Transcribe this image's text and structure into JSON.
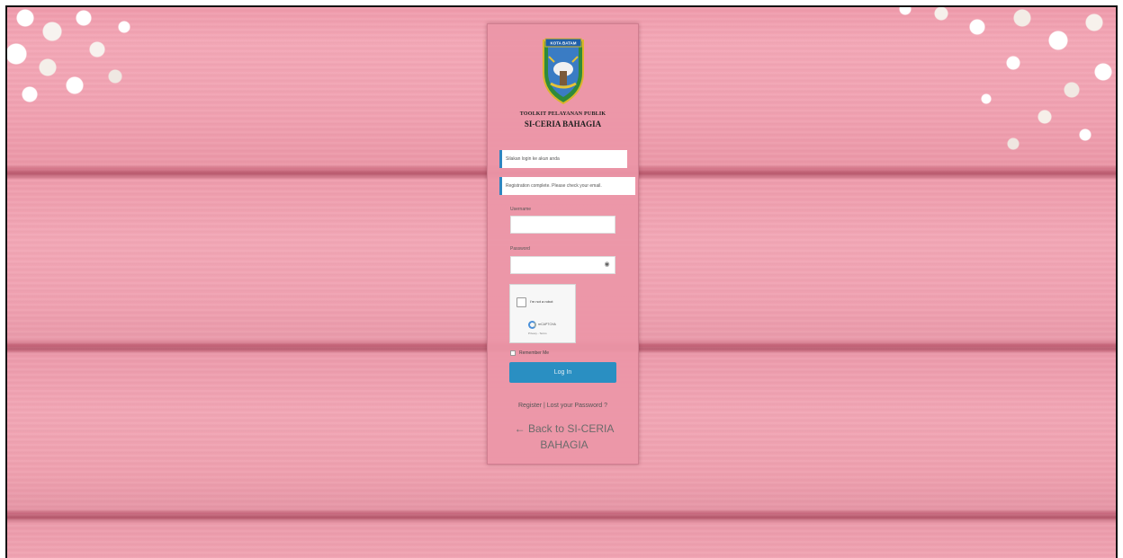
{
  "logo": {
    "banner_text": "KOTA BATAM",
    "icon": "regional-emblem-icon"
  },
  "header": {
    "subtitle": "TOOLKIT PELAYANAN PUBLIK",
    "title": "SI-CERIA BAHAGIA"
  },
  "notices": [
    "Silakan login ke akun anda",
    "Registration complete. Please check your email."
  ],
  "form": {
    "username_label": "Username",
    "username_value": "",
    "password_label": "Password",
    "password_value": "",
    "remember_label": "Remember Me",
    "remember_checked": false,
    "login_label": "Log In"
  },
  "captcha": {
    "label": "I'm not a robot",
    "brand": "reCAPTCHA",
    "terms": "Privacy - Terms"
  },
  "links": {
    "register": "Register | Lost your Password ?",
    "back": "← Back to SI-CERIA BAHAGIA"
  },
  "colors": {
    "background": "#f0a0b0",
    "button": "#2a8fc2",
    "notice_border": "#2e86c1"
  }
}
